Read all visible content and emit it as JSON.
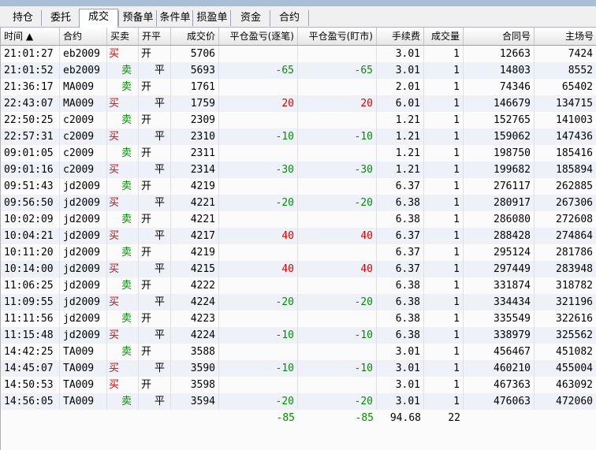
{
  "tabs": [
    {
      "label": "持仓"
    },
    {
      "label": "委托"
    },
    {
      "label": "成交",
      "active": true
    },
    {
      "label": "预备单"
    },
    {
      "label": "条件单"
    },
    {
      "label": "损盈单"
    },
    {
      "label": "资金"
    },
    {
      "label": "合约"
    }
  ],
  "columns": {
    "time": "时间 ▲",
    "contract": "合约",
    "side": "买卖",
    "openclose": "开平",
    "price": "成交价",
    "pnl_trade": "平仓盈亏(逐笔)",
    "pnl_mark": "平仓盈亏(盯市)",
    "fee": "手续费",
    "qty": "成交量",
    "contract_no": "合同号",
    "main_no": "主场号"
  },
  "colors": {
    "buy": "#e00000",
    "sell": "#009000",
    "profit": "#e00000",
    "loss": "#009000"
  },
  "rows": [
    {
      "time": "21:01:27",
      "contract": "eb2009",
      "side": "买",
      "oc": "开",
      "price": "5706",
      "pnl1": "",
      "pnl2": "",
      "fee": "3.01",
      "qty": "1",
      "cno": "12663",
      "mno": "7424"
    },
    {
      "time": "21:01:52",
      "contract": "eb2009",
      "side": "卖",
      "oc": "平",
      "price": "5693",
      "pnl1": "-65",
      "pnl2": "-65",
      "fee": "3.01",
      "qty": "1",
      "cno": "14803",
      "mno": "8552"
    },
    {
      "time": "21:36:17",
      "contract": "MA009",
      "side": "卖",
      "oc": "开",
      "price": "1761",
      "pnl1": "",
      "pnl2": "",
      "fee": "2.01",
      "qty": "1",
      "cno": "74346",
      "mno": "65402"
    },
    {
      "time": "22:43:07",
      "contract": "MA009",
      "side": "买",
      "oc": "平",
      "price": "1759",
      "pnl1": "20",
      "pnl2": "20",
      "fee": "6.01",
      "qty": "1",
      "cno": "146679",
      "mno": "134715"
    },
    {
      "time": "22:50:25",
      "contract": "c2009",
      "side": "卖",
      "oc": "开",
      "price": "2309",
      "pnl1": "",
      "pnl2": "",
      "fee": "1.21",
      "qty": "1",
      "cno": "152765",
      "mno": "141003"
    },
    {
      "time": "22:57:31",
      "contract": "c2009",
      "side": "买",
      "oc": "平",
      "price": "2310",
      "pnl1": "-10",
      "pnl2": "-10",
      "fee": "1.21",
      "qty": "1",
      "cno": "159062",
      "mno": "147436"
    },
    {
      "time": "09:01:05",
      "contract": "c2009",
      "side": "卖",
      "oc": "开",
      "price": "2311",
      "pnl1": "",
      "pnl2": "",
      "fee": "1.21",
      "qty": "1",
      "cno": "198750",
      "mno": "185416"
    },
    {
      "time": "09:01:16",
      "contract": "c2009",
      "side": "买",
      "oc": "平",
      "price": "2314",
      "pnl1": "-30",
      "pnl2": "-30",
      "fee": "1.21",
      "qty": "1",
      "cno": "199682",
      "mno": "185894"
    },
    {
      "time": "09:51:43",
      "contract": "jd2009",
      "side": "卖",
      "oc": "开",
      "price": "4219",
      "pnl1": "",
      "pnl2": "",
      "fee": "6.37",
      "qty": "1",
      "cno": "276117",
      "mno": "262885"
    },
    {
      "time": "09:56:50",
      "contract": "jd2009",
      "side": "买",
      "oc": "平",
      "price": "4221",
      "pnl1": "-20",
      "pnl2": "-20",
      "fee": "6.38",
      "qty": "1",
      "cno": "280917",
      "mno": "267306"
    },
    {
      "time": "10:02:09",
      "contract": "jd2009",
      "side": "卖",
      "oc": "开",
      "price": "4221",
      "pnl1": "",
      "pnl2": "",
      "fee": "6.38",
      "qty": "1",
      "cno": "286080",
      "mno": "272608"
    },
    {
      "time": "10:04:21",
      "contract": "jd2009",
      "side": "买",
      "oc": "平",
      "price": "4217",
      "pnl1": "40",
      "pnl2": "40",
      "fee": "6.37",
      "qty": "1",
      "cno": "288428",
      "mno": "274864"
    },
    {
      "time": "10:11:20",
      "contract": "jd2009",
      "side": "卖",
      "oc": "开",
      "price": "4219",
      "pnl1": "",
      "pnl2": "",
      "fee": "6.37",
      "qty": "1",
      "cno": "295124",
      "mno": "281786"
    },
    {
      "time": "10:14:00",
      "contract": "jd2009",
      "side": "买",
      "oc": "平",
      "price": "4215",
      "pnl1": "40",
      "pnl2": "40",
      "fee": "6.37",
      "qty": "1",
      "cno": "297449",
      "mno": "283948"
    },
    {
      "time": "11:06:25",
      "contract": "jd2009",
      "side": "卖",
      "oc": "开",
      "price": "4222",
      "pnl1": "",
      "pnl2": "",
      "fee": "6.38",
      "qty": "1",
      "cno": "331874",
      "mno": "318782"
    },
    {
      "time": "11:09:55",
      "contract": "jd2009",
      "side": "买",
      "oc": "平",
      "price": "4224",
      "pnl1": "-20",
      "pnl2": "-20",
      "fee": "6.38",
      "qty": "1",
      "cno": "334434",
      "mno": "321196"
    },
    {
      "time": "11:11:56",
      "contract": "jd2009",
      "side": "卖",
      "oc": "开",
      "price": "4223",
      "pnl1": "",
      "pnl2": "",
      "fee": "6.38",
      "qty": "1",
      "cno": "335549",
      "mno": "322616"
    },
    {
      "time": "11:15:48",
      "contract": "jd2009",
      "side": "买",
      "oc": "平",
      "price": "4224",
      "pnl1": "-10",
      "pnl2": "-10",
      "fee": "6.38",
      "qty": "1",
      "cno": "338979",
      "mno": "325562"
    },
    {
      "time": "14:42:25",
      "contract": "TA009",
      "side": "卖",
      "oc": "开",
      "price": "3588",
      "pnl1": "",
      "pnl2": "",
      "fee": "3.01",
      "qty": "1",
      "cno": "456467",
      "mno": "451082"
    },
    {
      "time": "14:45:07",
      "contract": "TA009",
      "side": "买",
      "oc": "平",
      "price": "3590",
      "pnl1": "-10",
      "pnl2": "-10",
      "fee": "3.01",
      "qty": "1",
      "cno": "460210",
      "mno": "455004"
    },
    {
      "time": "14:50:53",
      "contract": "TA009",
      "side": "买",
      "oc": "开",
      "price": "3598",
      "pnl1": "",
      "pnl2": "",
      "fee": "3.01",
      "qty": "1",
      "cno": "467363",
      "mno": "463092"
    },
    {
      "time": "14:56:05",
      "contract": "TA009",
      "side": "卖",
      "oc": "平",
      "price": "3594",
      "pnl1": "-20",
      "pnl2": "-20",
      "fee": "3.01",
      "qty": "1",
      "cno": "476063",
      "mno": "472060"
    }
  ],
  "totals": {
    "pnl1": "-85",
    "pnl2": "-85",
    "fee": "94.68",
    "qty": "22"
  }
}
